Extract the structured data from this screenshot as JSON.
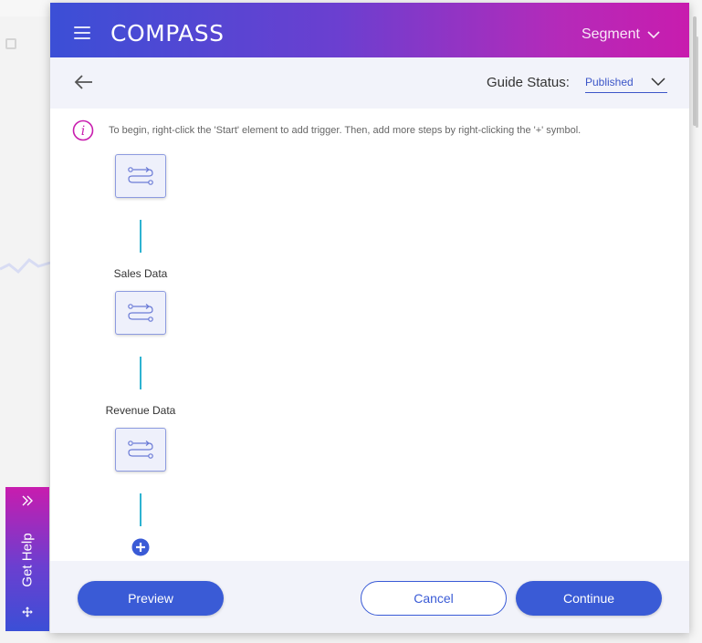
{
  "header": {
    "brand": "COMPASS",
    "segment_label": "Segment"
  },
  "subbar": {
    "status_label": "Guide Status:",
    "status_value": "Published"
  },
  "info": {
    "text": "To begin, right-click the 'Start' element to add trigger. Then, add more steps by right-clicking the '+' symbol."
  },
  "flow": {
    "steps": [
      {
        "label": ""
      },
      {
        "label": "Sales Data"
      },
      {
        "label": "Revenue Data"
      }
    ]
  },
  "footer": {
    "preview_label": "Preview",
    "cancel_label": "Cancel",
    "continue_label": "Continue"
  },
  "help_tab": {
    "label": "Get Help"
  },
  "icons": {
    "menu": "hamburger-icon",
    "back": "arrow-left-icon",
    "chevron": "chevron-down-icon",
    "info": "info-icon",
    "step": "flow-steps-icon",
    "add": "plus-circle-icon",
    "expand": "double-chevron-right-icon",
    "drag": "move-icon"
  },
  "colors": {
    "brand_blue": "#3a5bd6",
    "brand_magenta": "#c81cae",
    "connector": "#2eb3d1"
  }
}
